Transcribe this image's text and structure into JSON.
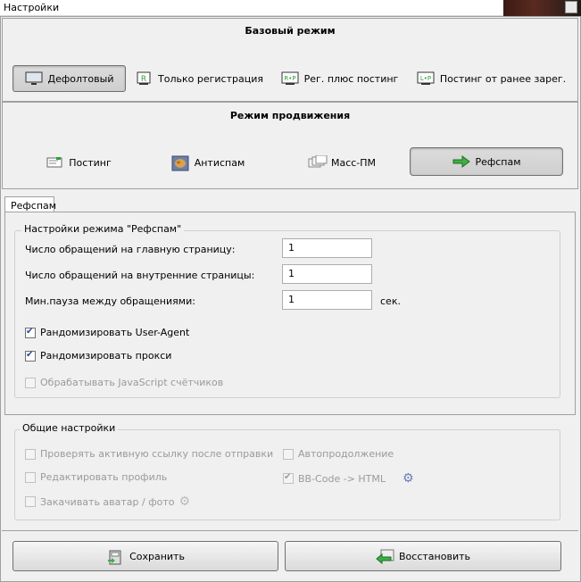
{
  "window": {
    "title": "Настройки"
  },
  "base_mode": {
    "title": "Базовый режим",
    "buttons": [
      {
        "label": "Дефолтовый",
        "icon": "monitor-icon",
        "active": true
      },
      {
        "label": "Только регистрация",
        "icon": "register-icon",
        "badge": "R"
      },
      {
        "label": "Рег. плюс постинг",
        "icon": "register-posting-icon",
        "badge": "R•P"
      },
      {
        "label": "Постинг от ранее зарег.",
        "icon": "login-posting-icon",
        "badge": "L•P"
      }
    ]
  },
  "promo_mode": {
    "title": "Режим продвижения",
    "buttons": [
      {
        "label": "Постинг",
        "icon": "posting-icon"
      },
      {
        "label": "Антиспам",
        "icon": "antispam-icon"
      },
      {
        "label": "Масс-ПМ",
        "icon": "mass-pm-icon"
      },
      {
        "label": "Рефспам",
        "icon": "refspam-icon",
        "active": true
      }
    ]
  },
  "tab": {
    "label": "Рефспам"
  },
  "refspam_settings": {
    "group_title": "Настройки режима \"Рефспам\"",
    "fields": [
      {
        "label": "Число обращений на главную страницу:",
        "value": "1"
      },
      {
        "label": "Число обращений на внутренние страницы:",
        "value": "1"
      },
      {
        "label": "Мин.пауза между обращениями:",
        "value": "1",
        "unit": "сек."
      }
    ],
    "checkboxes": [
      {
        "label": "Рандомизировать User-Agent",
        "checked": true,
        "enabled": true
      },
      {
        "label": "Рандомизировать прокси",
        "checked": true,
        "enabled": true
      },
      {
        "label": "Обрабатывать JavaScript счётчиков",
        "checked": false,
        "enabled": false
      }
    ]
  },
  "general_settings": {
    "group_title": "Общие настройки",
    "left": [
      {
        "label": "Проверять активную ссылку после отправки",
        "checked": false
      },
      {
        "label": "Редактировать профиль",
        "checked": false
      },
      {
        "label": "Закачивать аватар / фото",
        "checked": false
      }
    ],
    "right": [
      {
        "label": "Автопродолжение",
        "checked": false
      },
      {
        "label": "BB-Code -> HTML",
        "checked": true
      }
    ]
  },
  "footer": {
    "save_label": "Сохранить",
    "restore_label": "Восстановить"
  },
  "colors": {
    "accent_green": "#2e9e3a",
    "gear_blue": "#6a7ab8"
  }
}
